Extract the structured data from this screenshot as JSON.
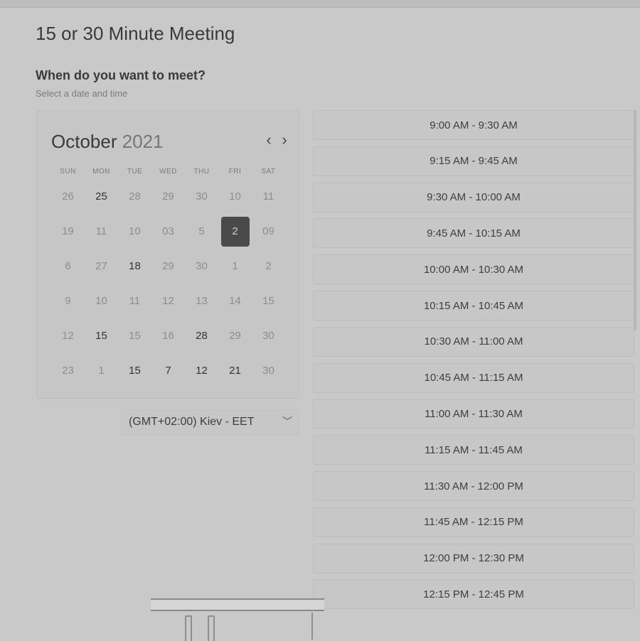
{
  "header": {
    "title": "15 or 30 Minute Meeting",
    "question": "When do you want to meet?",
    "subtext": "Select a date and time"
  },
  "calendar": {
    "month": "October",
    "year": "2021",
    "prev_icon": "chevron-left-icon",
    "next_icon": "chevron-right-icon",
    "weekdays": [
      "SUN",
      "MON",
      "TUE",
      "WED",
      "THU",
      "FRI",
      "SAT"
    ],
    "days": [
      "26",
      "25",
      "28",
      "29",
      "30",
      "10",
      "11",
      "19",
      "11",
      "10",
      "03",
      "5",
      "2",
      "09",
      "6",
      "27",
      "18",
      "29",
      "30",
      "1",
      "2",
      "9",
      "10",
      "11",
      "12",
      "13",
      "14",
      "15",
      "12",
      "15",
      "15",
      "16",
      "28",
      "29",
      "30",
      "23",
      "1",
      "15",
      "7",
      "12",
      "21",
      "30"
    ],
    "available_days": [
      "25",
      "18",
      "15",
      "28",
      "1",
      "7",
      "12",
      "21"
    ],
    "selected_day": "2"
  },
  "timezone": {
    "value": "(GMT+02:00) Kiev - EET",
    "icon": "chevron-down-icon"
  },
  "time_slots": [
    "9:00 AM - 9:30 AM",
    "9:15 AM - 9:45 AM",
    "9:30 AM - 10:00 AM",
    "9:45 AM - 10:15 AM",
    "10:00 AM - 10:30 AM",
    "10:15 AM - 10:45 AM",
    "10:30 AM - 11:00 AM",
    "10:45 AM - 11:15 AM",
    "11:00 AM - 11:30 AM",
    "11:15 AM - 11:45 AM",
    "11:30 AM - 12:00 PM",
    "11:45 AM - 12:15 PM",
    "12:00 PM - 12:30 PM",
    "12:15 PM - 12:45 PM"
  ]
}
